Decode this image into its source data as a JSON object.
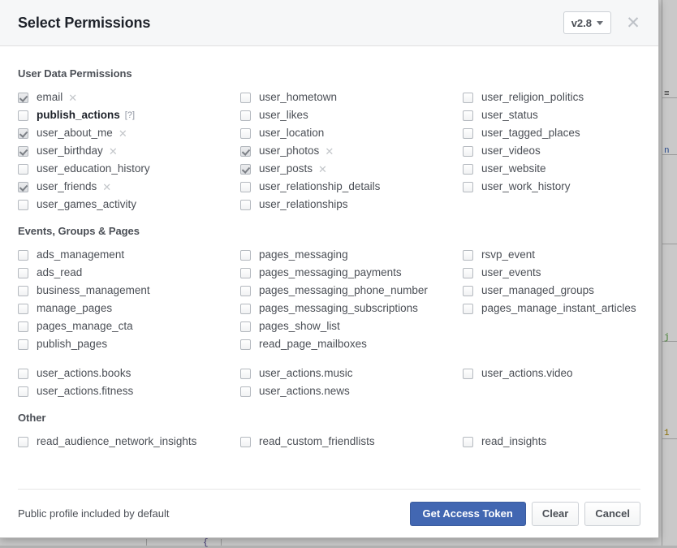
{
  "header": {
    "title": "Select Permissions",
    "version_label": "v2.8",
    "close_label": "✕"
  },
  "sections": [
    {
      "title": "User Data Permissions",
      "groups": [
        {
          "rows": 7,
          "items": [
            {
              "label": "email",
              "checked": true,
              "removable": true
            },
            {
              "label": "publish_actions",
              "checked": false,
              "bold": true,
              "help": "[?]"
            },
            {
              "label": "user_about_me",
              "checked": true,
              "removable": true
            },
            {
              "label": "user_birthday",
              "checked": true,
              "removable": true
            },
            {
              "label": "user_education_history",
              "checked": false
            },
            {
              "label": "user_friends",
              "checked": true,
              "removable": true
            },
            {
              "label": "user_games_activity",
              "checked": false
            },
            {
              "label": "user_hometown",
              "checked": false
            },
            {
              "label": "user_likes",
              "checked": false
            },
            {
              "label": "user_location",
              "checked": false
            },
            {
              "label": "user_photos",
              "checked": true,
              "removable": true
            },
            {
              "label": "user_posts",
              "checked": true,
              "removable": true
            },
            {
              "label": "user_relationship_details",
              "checked": false
            },
            {
              "label": "user_relationships",
              "checked": false
            },
            {
              "label": "user_religion_politics",
              "checked": false
            },
            {
              "label": "user_status",
              "checked": false
            },
            {
              "label": "user_tagged_places",
              "checked": false
            },
            {
              "label": "user_videos",
              "checked": false
            },
            {
              "label": "user_website",
              "checked": false
            },
            {
              "label": "user_work_history",
              "checked": false
            }
          ]
        }
      ]
    },
    {
      "title": "Events, Groups & Pages",
      "groups": [
        {
          "rows": 6,
          "items": [
            {
              "label": "ads_management",
              "checked": false
            },
            {
              "label": "ads_read",
              "checked": false
            },
            {
              "label": "business_management",
              "checked": false
            },
            {
              "label": "manage_pages",
              "checked": false
            },
            {
              "label": "pages_manage_cta",
              "checked": false
            },
            {
              "label": "publish_pages",
              "checked": false
            },
            {
              "label": "pages_messaging",
              "checked": false
            },
            {
              "label": "pages_messaging_payments",
              "checked": false
            },
            {
              "label": "pages_messaging_phone_number",
              "checked": false
            },
            {
              "label": "pages_messaging_subscriptions",
              "checked": false
            },
            {
              "label": "pages_show_list",
              "checked": false
            },
            {
              "label": "read_page_mailboxes",
              "checked": false
            },
            {
              "label": "rsvp_event",
              "checked": false
            },
            {
              "label": "user_events",
              "checked": false
            },
            {
              "label": "user_managed_groups",
              "checked": false
            },
            {
              "label": "pages_manage_instant_articles",
              "checked": false
            }
          ]
        },
        {
          "rows": 2,
          "items": [
            {
              "label": "user_actions.books",
              "checked": false
            },
            {
              "label": "user_actions.fitness",
              "checked": false
            },
            {
              "label": "user_actions.music",
              "checked": false
            },
            {
              "label": "user_actions.news",
              "checked": false
            },
            {
              "label": "user_actions.video",
              "checked": false
            }
          ]
        }
      ]
    },
    {
      "title": "Other",
      "groups": [
        {
          "rows": 1,
          "items": [
            {
              "label": "read_audience_network_insights",
              "checked": false
            },
            {
              "label": "read_custom_friendlists",
              "checked": false
            },
            {
              "label": "read_insights",
              "checked": false
            }
          ]
        }
      ]
    }
  ],
  "footer": {
    "note": "Public profile included by default",
    "get_access_token_label": "Get Access Token",
    "clear_label": "Clear",
    "cancel_label": "Cancel"
  },
  "colors": {
    "primary": "#4267b2",
    "header_bg": "#f6f7f8",
    "text": "#4b4f56"
  }
}
